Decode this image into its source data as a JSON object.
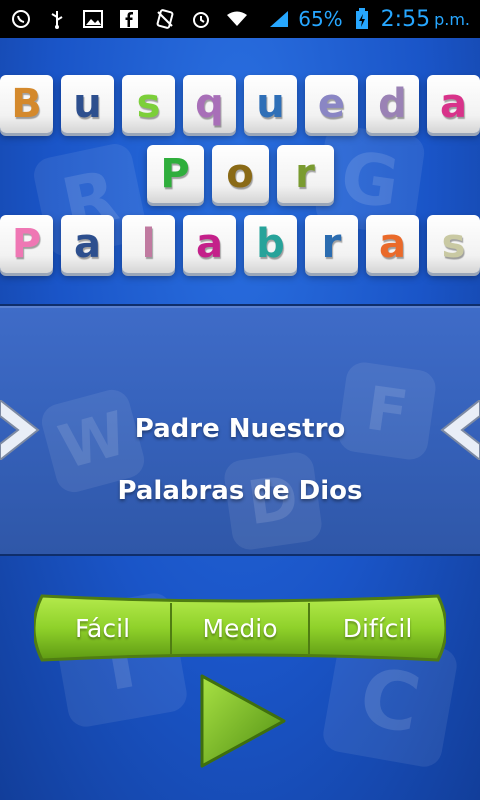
{
  "status_bar": {
    "battery_percent": "65%",
    "time": "2:55",
    "ampm": "p.m.",
    "icons": [
      "whatsapp-icon",
      "usb-icon",
      "image-icon",
      "facebook-icon",
      "no-sim-icon",
      "alarm-icon",
      "wifi-icon",
      "signal-icon",
      "battery-icon"
    ]
  },
  "title": {
    "rows": [
      [
        {
          "ch": "B",
          "color": "#d4892c"
        },
        {
          "ch": "u",
          "color": "#2d4f8e"
        },
        {
          "ch": "s",
          "color": "#7ccf3a"
        },
        {
          "ch": "q",
          "color": "#a86fb8"
        },
        {
          "ch": "u",
          "color": "#2f6fb7"
        },
        {
          "ch": "e",
          "color": "#8a86c4"
        },
        {
          "ch": "d",
          "color": "#9a82b5"
        },
        {
          "ch": "a",
          "color": "#d8338a"
        }
      ],
      [
        {
          "ch": "P",
          "color": "#2fae3c"
        },
        {
          "ch": "o",
          "color": "#8a6a16"
        },
        {
          "ch": "r",
          "color": "#7a9b30"
        }
      ],
      [
        {
          "ch": "P",
          "color": "#ef77b4"
        },
        {
          "ch": "a",
          "color": "#2d4f8e"
        },
        {
          "ch": "l",
          "color": "#c07aa0"
        },
        {
          "ch": "a",
          "color": "#c4208a"
        },
        {
          "ch": "b",
          "color": "#27a39a"
        },
        {
          "ch": "r",
          "color": "#2b6cb0"
        },
        {
          "ch": "a",
          "color": "#ea6a2a"
        },
        {
          "ch": "s",
          "color": "#c9c9a3"
        }
      ]
    ]
  },
  "puzzle_list": {
    "items": [
      "Padre Nuestro",
      "Palabras de Dios"
    ]
  },
  "difficulty": {
    "options": [
      "Fácil",
      "Medio",
      "Difícil"
    ]
  },
  "colors": {
    "background": "#1a55c8",
    "panel": "#3561ba",
    "selector_green": "#8fd12a",
    "play_green": "#6fb51c"
  }
}
